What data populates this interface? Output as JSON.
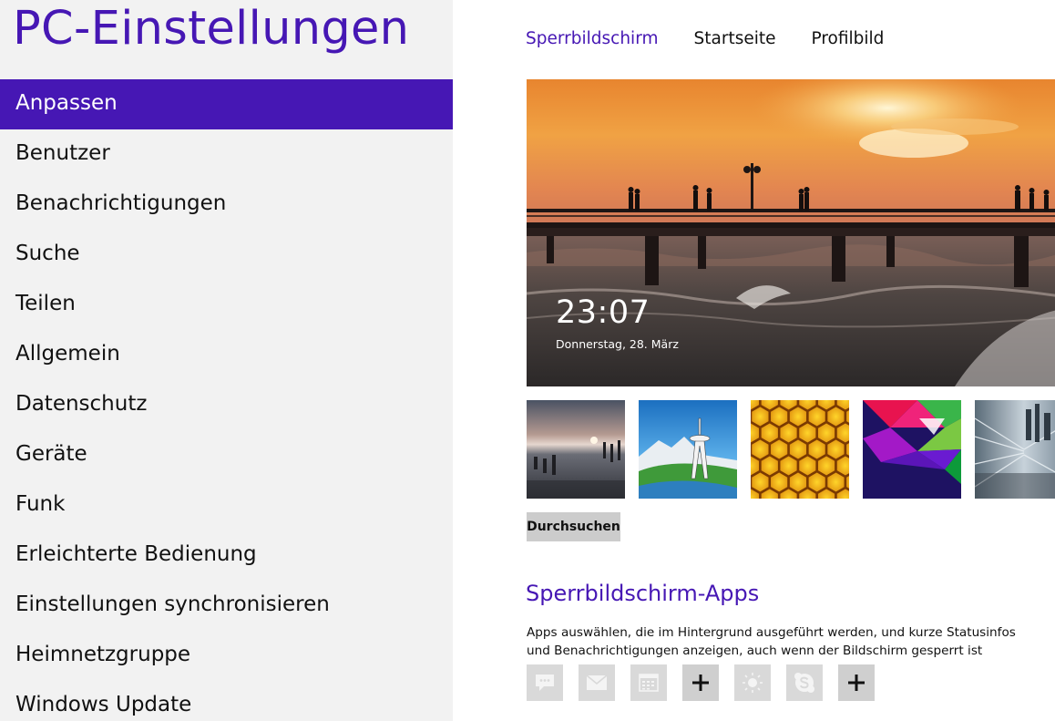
{
  "app_title": "PC-Einstellungen",
  "sidebar": {
    "items": [
      {
        "label": "Anpassen",
        "active": true
      },
      {
        "label": "Benutzer"
      },
      {
        "label": "Benachrichtigungen"
      },
      {
        "label": "Suche"
      },
      {
        "label": "Teilen"
      },
      {
        "label": "Allgemein"
      },
      {
        "label": "Datenschutz"
      },
      {
        "label": "Geräte"
      },
      {
        "label": "Funk"
      },
      {
        "label": "Erleichterte Bedienung"
      },
      {
        "label": "Einstellungen synchronisieren"
      },
      {
        "label": "Heimnetzgruppe"
      },
      {
        "label": "Windows Update"
      }
    ]
  },
  "tabs": [
    {
      "label": "Sperrbildschirm",
      "active": true
    },
    {
      "label": "Startseite"
    },
    {
      "label": "Profilbild"
    }
  ],
  "preview": {
    "time": "23:07",
    "date": "Donnerstag, 28. März"
  },
  "thumbnails": [
    "sunset-sea-image",
    "space-needle-image",
    "honeycomb-image",
    "color-triangles-image",
    "light-tunnel-image"
  ],
  "browse_label": "Durchsuchen",
  "apps_section": {
    "heading": "Sperrbildschirm-Apps",
    "description": "Apps auswählen, die im Hintergrund ausgeführt werden, und kurze Statusinfos und Benachrichtigungen anzeigen, auch wenn der Bildschirm gesperrt ist",
    "slots": [
      "messaging-icon",
      "mail-icon",
      "calendar-icon",
      "plus-icon",
      "weather-sun-icon",
      "skype-icon",
      "plus-icon"
    ]
  },
  "colors": {
    "accent": "#4617b4",
    "sidebar_bg": "#f2f2f2"
  }
}
